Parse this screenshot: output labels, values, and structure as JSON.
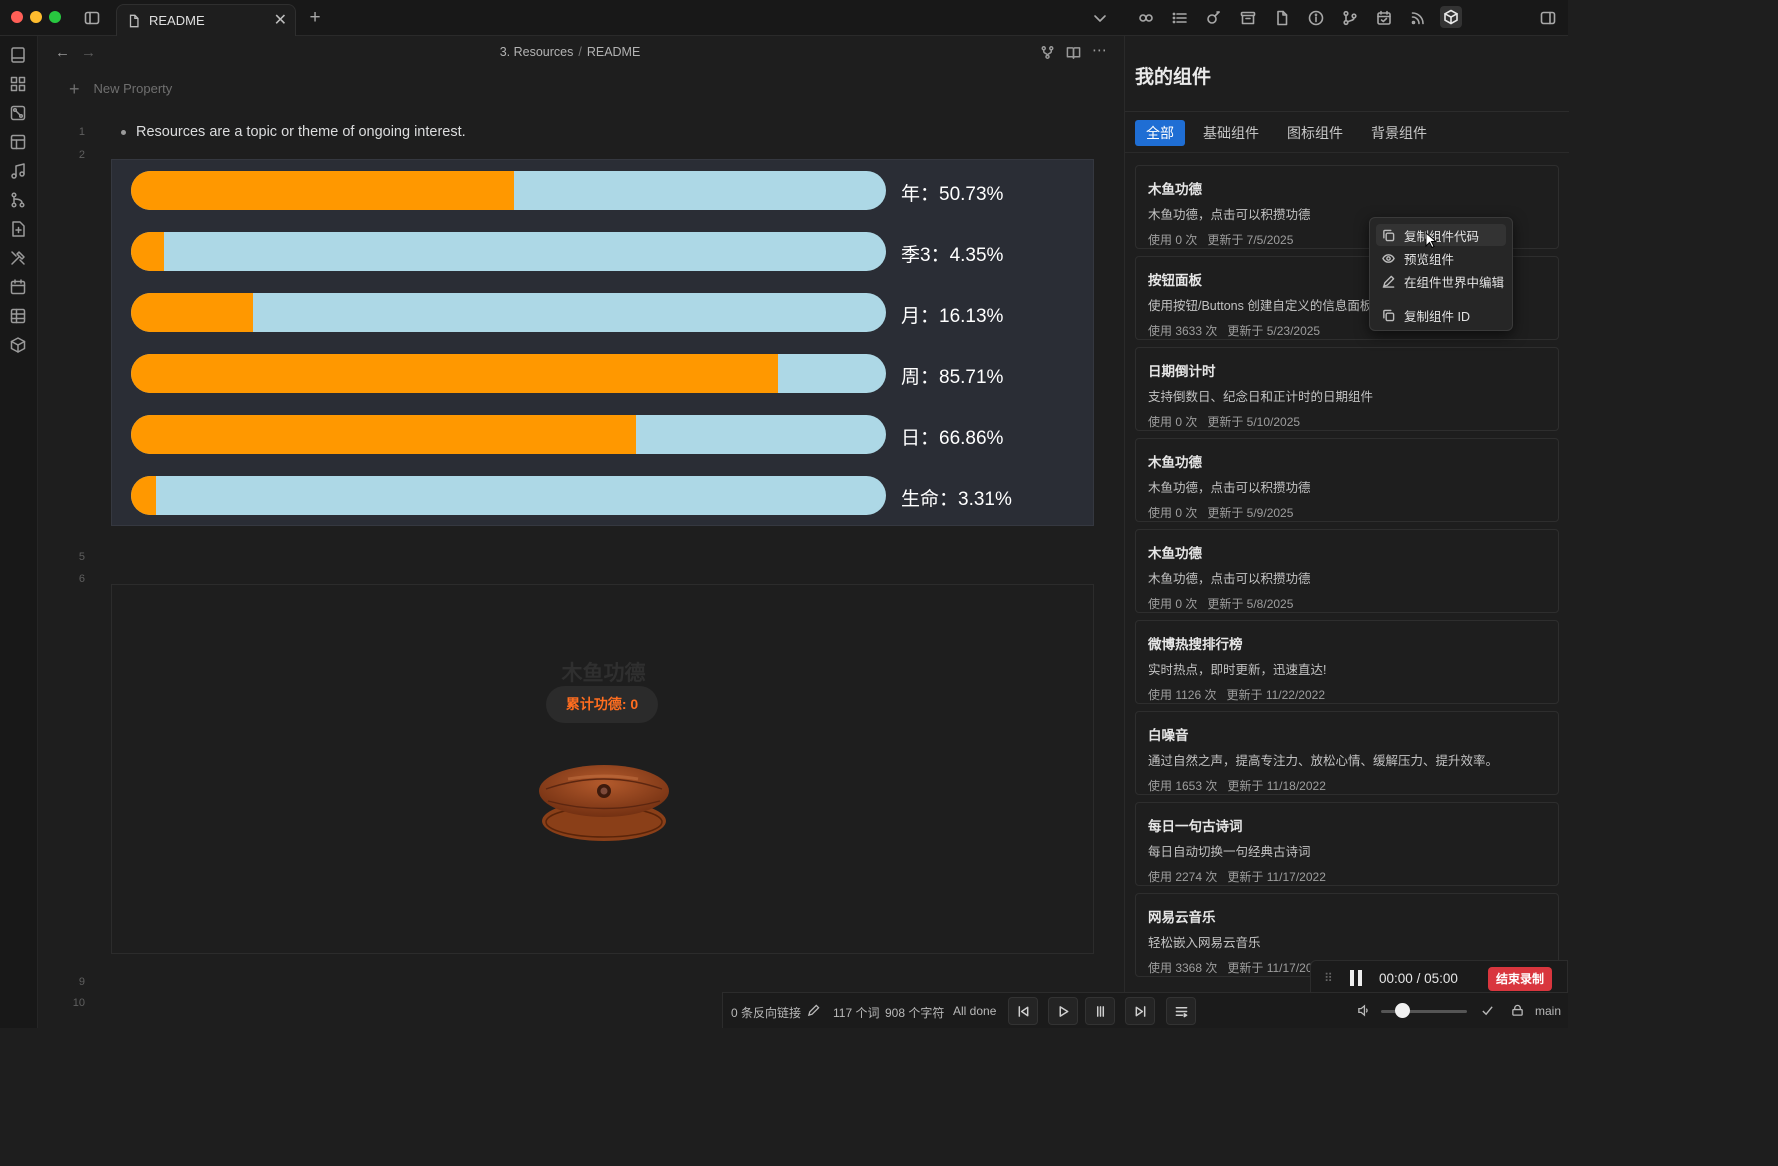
{
  "window": {
    "tab_title": "README",
    "traffic_colors": [
      "#ff5f57",
      "#febc2e",
      "#28c840"
    ]
  },
  "toolbar_icons": [
    "sidebar-toggle-icon",
    "link-icon",
    "list-icon",
    "plugin-icon",
    "archive-icon",
    "file-icon",
    "info-icon",
    "git-icon",
    "calendar-icon",
    "rss-icon",
    "cube-icon",
    "right-sidebar-icon"
  ],
  "rail_icons": [
    "files-icon",
    "grid-icon",
    "graph-icon",
    "layout-icon",
    "music-icon",
    "branch-icon",
    "note-icon",
    "tools-icon",
    "calendar-icon",
    "table-icon",
    "cube-icon"
  ],
  "editor": {
    "breadcrumb_folder": "3. Resources",
    "breadcrumb_sep": "/",
    "breadcrumb_file": "README",
    "new_property": "New Property",
    "line_numbers": [
      "1",
      "2",
      "5",
      "6",
      "9",
      "10"
    ],
    "bullet_text": "Resources are a topic or theme of ongoing interest."
  },
  "progress": {
    "colors": {
      "fill": "#ff9800",
      "track": "#add8e6"
    },
    "rows": [
      {
        "label": "年：50.73%",
        "value": 50.73
      },
      {
        "label": "季3：4.35%",
        "value": 4.35
      },
      {
        "label": "月：16.13%",
        "value": 16.13
      },
      {
        "label": "周：85.71%",
        "value": 85.71
      },
      {
        "label": "日：66.86%",
        "value": 66.86
      },
      {
        "label": "生命：3.31%",
        "value": 3.31
      }
    ]
  },
  "woodfish": {
    "title": "木鱼功德",
    "counter": "累计功德: 0"
  },
  "panel": {
    "title": "我的组件",
    "tabs": [
      "全部",
      "基础组件",
      "图标组件",
      "背景组件"
    ],
    "cards": [
      {
        "name": "木鱼功德",
        "desc": "木鱼功德，点击可以积攒功德",
        "uses": "使用 0 次",
        "updated": "更新于 7/5/2025"
      },
      {
        "name": "按钮面板",
        "desc": "使用按钮/Buttons 创建自定义的信息面板",
        "uses": "使用 3633 次",
        "updated": "更新于 5/23/2025"
      },
      {
        "name": "日期倒计时",
        "desc": "支持倒数日、纪念日和正计时的日期组件",
        "uses": "使用 0 次",
        "updated": "更新于 5/10/2025"
      },
      {
        "name": "木鱼功德",
        "desc": "木鱼功德，点击可以积攒功德",
        "uses": "使用 0 次",
        "updated": "更新于 5/9/2025"
      },
      {
        "name": "木鱼功德",
        "desc": "木鱼功德，点击可以积攒功德",
        "uses": "使用 0 次",
        "updated": "更新于 5/8/2025"
      },
      {
        "name": "微博热搜排行榜",
        "desc": "实时热点，即时更新，迅速直达!",
        "uses": "使用 1126 次",
        "updated": "更新于 11/22/2022"
      },
      {
        "name": "白噪音",
        "desc": "通过自然之声，提高专注力、放松心情、缓解压力、提升效率。",
        "uses": "使用 1653 次",
        "updated": "更新于 11/18/2022"
      },
      {
        "name": "每日一句古诗词",
        "desc": "每日自动切换一句经典古诗词",
        "uses": "使用 2274 次",
        "updated": "更新于 11/17/2022"
      },
      {
        "name": "网易云音乐",
        "desc": "轻松嵌入网易云音乐",
        "uses": "使用 3368 次",
        "updated": "更新于 11/17/2022"
      }
    ]
  },
  "context_menu": {
    "items": [
      "复制组件代码",
      "预览组件",
      "在组件世界中编辑",
      "复制组件 ID"
    ]
  },
  "status": {
    "backlinks": "0 条反向链接",
    "words": "117 个词",
    "chars": "908 个字符",
    "sync": "All done",
    "branch": "main"
  },
  "recorder": {
    "elapsed": "00:00",
    "sep": "/",
    "total": "05:00",
    "stop_label": "结束录制"
  }
}
